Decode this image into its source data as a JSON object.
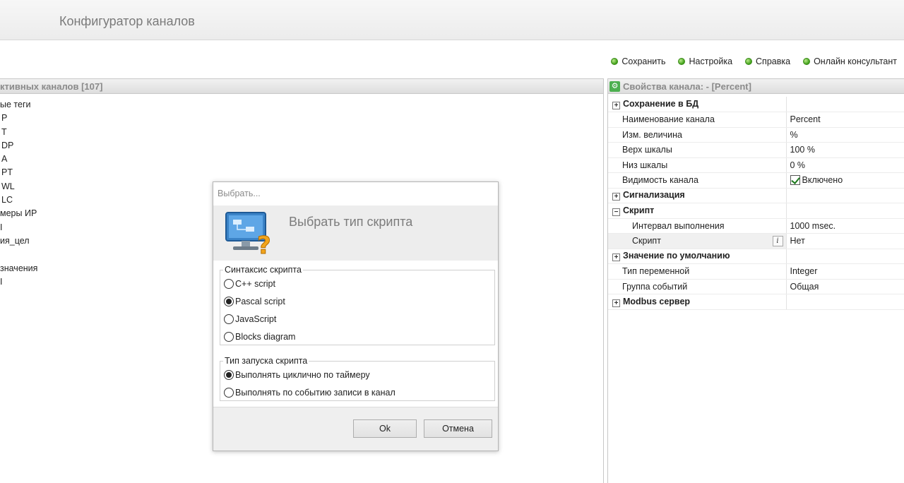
{
  "header": {
    "title": "Конфигуратор каналов"
  },
  "toolbar": {
    "save": "Сохранить",
    "settings": "Настройка",
    "help": "Справка",
    "online": "Онлайн консультант"
  },
  "left": {
    "title": "ктивных каналов [107]",
    "items": [
      "ые теги",
      "P",
      "T",
      "DP",
      "A",
      "PT",
      "WL",
      "LC",
      "меры ИР",
      "I",
      "ия_цел",
      "",
      " значения",
      "I"
    ]
  },
  "right": {
    "title": "Свойства канала: - [Percent]",
    "rows": {
      "save_db": "Сохранение в БД",
      "name_k": "Наименование канала",
      "name_v": "Percent",
      "unit_k": "Изм. величина",
      "unit_v": " %",
      "top_k": "Верх шкалы",
      "top_v": "100 %",
      "bottom_k": "Низ шкалы",
      "bottom_v": "0 %",
      "vis_k": "Видимость канала",
      "vis_v": "Включено",
      "alarm": "Сигнализация",
      "script_grp": "Скрипт",
      "interval_k": "Интервал выполнения",
      "interval_v": "1000 msec.",
      "script_k": "Скрипт",
      "script_v": "Нет",
      "default_grp": "Значение по умолчанию",
      "vartype_k": "Тип переменной",
      "vartype_v": "Integer",
      "evgroup_k": "Группа событий",
      "evgroup_v": "Общая",
      "modbus": "Modbus сервер"
    }
  },
  "dialog": {
    "title": "Выбрать...",
    "banner": "Выбрать тип скрипта",
    "syntax_legend": "Синтаксис скрипта",
    "syntax_options": [
      "C++ script",
      "Pascal script",
      "JavaScript",
      "Blocks diagram"
    ],
    "syntax_selected": 1,
    "run_legend": "Тип запуска скрипта",
    "run_options": [
      "Выполнять циклично по таймеру",
      "Выполнять по событию записи в канал"
    ],
    "run_selected": 0,
    "ok": "Ok",
    "cancel": "Отмена"
  },
  "colors": {
    "accent_green": "#3fa018"
  }
}
